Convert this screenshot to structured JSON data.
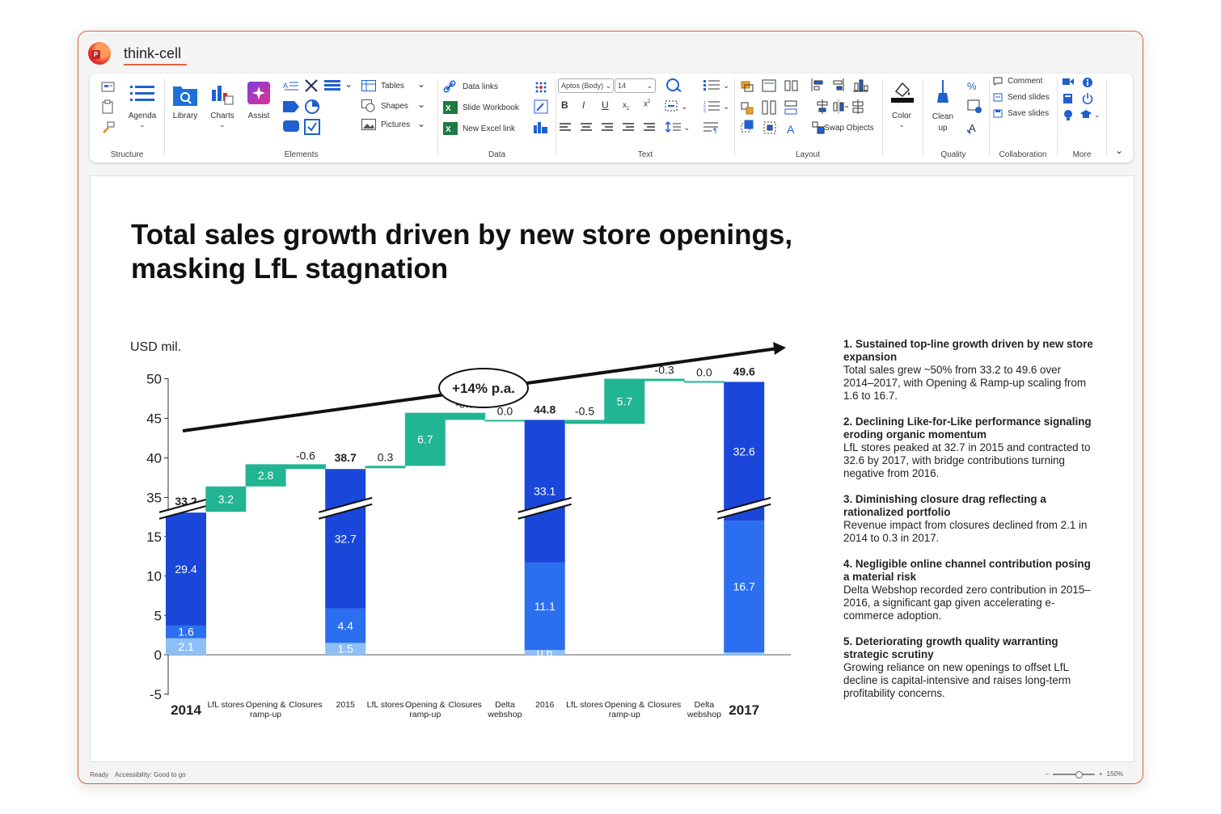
{
  "app": {
    "title": "think-cell",
    "logo_letter": "P"
  },
  "ribbon": {
    "structure": {
      "label": "Structure",
      "agenda": "Agenda"
    },
    "elements": {
      "label": "Elements",
      "library": "Library",
      "charts": "Charts",
      "assist": "Assist",
      "tables": "Tables",
      "shapes": "Shapes",
      "pictures": "Pictures"
    },
    "data": {
      "label": "Data",
      "data_links": "Data links",
      "slide_workbook": "Slide Workbook",
      "new_excel_link": "New Excel link"
    },
    "text": {
      "label": "Text",
      "font": "Aptos (Body)",
      "size": "14"
    },
    "layout": {
      "label": "Layout",
      "swap_objects": "Swap Objects"
    },
    "color": {
      "label": "Color"
    },
    "quality": {
      "label": "Quality",
      "clean_up_1": "Clean",
      "clean_up_2": "up"
    },
    "collaboration": {
      "label": "Collaboration",
      "comment": "Comment",
      "send_slides": "Send slides",
      "save_slides": "Save slides"
    },
    "more": {
      "label": "More"
    }
  },
  "slide": {
    "title_line1": "Total sales growth driven by new store openings,",
    "title_line2": "masking LfL stagnation",
    "unit_label": "USD mil.",
    "cagr_label": "+14% p.a."
  },
  "chart_data": {
    "type": "waterfall",
    "ylabel": "USD mil.",
    "ylim": [
      -5,
      50
    ],
    "axis_break": "between 15 and 35",
    "y_ticks": [
      "50",
      "45",
      "40",
      "35",
      "15",
      "10",
      "5",
      "0",
      "-5"
    ],
    "categories": [
      {
        "label": "2014",
        "bold": true
      },
      {
        "label": "LfL stores"
      },
      {
        "label": "Opening &\nramp-up"
      },
      {
        "label": "Closures"
      },
      {
        "label": "2015"
      },
      {
        "label": "LfL stores"
      },
      {
        "label": "Opening &\nramp-up"
      },
      {
        "label": "Closures"
      },
      {
        "label": "Delta\nwebshop"
      },
      {
        "label": "2016"
      },
      {
        "label": "LfL stores"
      },
      {
        "label": "Opening &\nramp-up"
      },
      {
        "label": "Closures"
      },
      {
        "label": "Delta\nwebshop"
      },
      {
        "label": "2017",
        "bold": true
      }
    ],
    "totals": [
      {
        "category": "2014",
        "total": "33.2",
        "segments": [
          {
            "label": "2.1",
            "value": 2.1
          },
          {
            "label": "1.6",
            "value": 1.6
          },
          {
            "label": "29.4",
            "value": 29.4
          }
        ]
      },
      {
        "category": "2015",
        "total": "38.7",
        "segments": [
          {
            "label": "1.5",
            "value": 1.5
          },
          {
            "label": "4.4",
            "value": 4.4
          },
          {
            "label": "32.7",
            "value": 32.7
          }
        ]
      },
      {
        "category": "2016",
        "total": "44.8",
        "segments": [
          {
            "label": "0.6",
            "value": 0.6
          },
          {
            "label": "11.1",
            "value": 11.1
          },
          {
            "label": "33.1",
            "value": 33.1
          }
        ]
      },
      {
        "category": "2017",
        "total": "49.6",
        "segments": [
          {
            "label": "",
            "value": 0.3
          },
          {
            "label": "16.7",
            "value": 16.7
          },
          {
            "label": "32.6",
            "value": 32.6
          }
        ]
      }
    ],
    "deltas": [
      {
        "label": "3.2",
        "value": 3.2
      },
      {
        "label": "2.8",
        "value": 2.8
      },
      {
        "label": "-0.6",
        "value": -0.6
      },
      {
        "label": "0.3",
        "value": 0.3
      },
      {
        "label": "6.7",
        "value": 6.7
      },
      {
        "label": "-0.9",
        "value": -0.9
      },
      {
        "label": "0.0",
        "value": 0.0
      },
      {
        "label": "-0.5",
        "value": -0.5
      },
      {
        "label": "5.7",
        "value": 5.7
      },
      {
        "label": "-0.3",
        "value": -0.3
      },
      {
        "label": "0.0",
        "value": 0.0
      }
    ],
    "colors": {
      "segment_dark": "#1a47d9",
      "segment_mid": "#2b6ff0",
      "segment_light": "#8ec0f7",
      "delta": "#22b593"
    }
  },
  "notes": [
    {
      "heading": "1. Sustained top-line growth driven by new store expansion",
      "body": "Total sales grew ~50% from 33.2 to 49.6 over 2014–2017, with Opening & Ramp-up scaling from 1.6 to 16.7."
    },
    {
      "heading": "2. Declining Like-for-Like performance signaling eroding organic momentum",
      "body": "LfL stores peaked at 32.7 in 2015 and contracted to 32.6 by 2017, with bridge contributions turning negative from 2016."
    },
    {
      "heading": "3. Diminishing closure drag reflecting a rationalized portfolio",
      "body": "Revenue impact from closures declined from 2.1 in 2014 to 0.3 in 2017."
    },
    {
      "heading": "4. Negligible online channel contribution posing a material risk",
      "body": "Delta Webshop recorded zero contribution in 2015–2016, a significant gap given accelerating e-commerce adoption."
    },
    {
      "heading": "5. Deteriorating growth quality warranting strategic scrutiny",
      "body": "Growing reliance on new openings to offset LfL decline is capital-intensive and raises long-term profitability concerns."
    }
  ],
  "status": {
    "ready": "Ready",
    "accessibility": "Accessibility: Good to go",
    "zoom": "150%"
  }
}
